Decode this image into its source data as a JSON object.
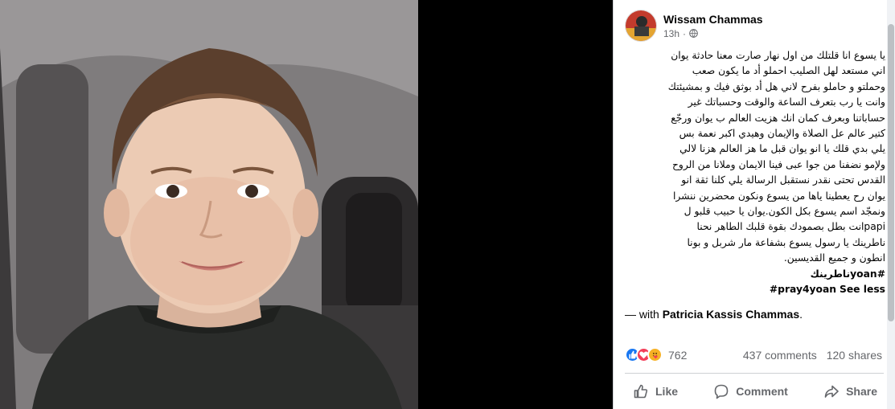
{
  "post": {
    "author": "Wissam Chammas",
    "time": "13h",
    "body_lines": [
      "يا يسوع انا قلتلك من اول نهار صارت معنا حادثة يوان",
      "اني مستعد لهل الصليب احملو أد ما يكون صعب",
      "وحملتو و حاملو بفرح لاني هل أد بوثق فيك و بمشيئتك",
      "وانت يا رب بتعرف الساعة والوقت وحسباتك غير",
      "حساباتنا وبعرف كمان انك هزيت العالم ب يوان ورجّع",
      "كتير عالم عل الصلاة والإيمان وهيدي اكبر نعمة بس",
      "يلي بدي قلك يا انو يوان قبل ما هز العالم هزنا لالي",
      "ولإمو نضفنا من جوا عبى فينا الايمان وملانا من الروح",
      "القدس تحتى نقدر نستقبل الرسالة يلي كلنا ثقة انو",
      "يوان رح يعطينا ياها من يسوع ونكون محضرين ننشرا",
      "ونمجّد اسم يسوع بكل الكون.يوان يا حبيب قلبو ل",
      "papiانت بطل بصمودك بقوة قلبك الطاهر نحنا",
      "ناطرينك يا رسول يسوع بشفاعة مار شربل و بونا",
      "انطون و جميع القديسين."
    ],
    "hashtag_1": "#yoanناطرينك",
    "hashtag_2": "#pray4yoan",
    "see_less": "See less",
    "with_prefix": "— with ",
    "with_name": "Patricia Kassis Chammas",
    "with_suffix": "."
  },
  "stats": {
    "reaction_count": "762",
    "comments": "437 comments",
    "shares": "120 shares"
  },
  "actions": {
    "like": "Like",
    "comment": "Comment",
    "share": "Share"
  },
  "colors": {
    "like_blue": "#1877f2",
    "love_red": "#f33e58",
    "care_yellow": "#f7b125",
    "secondary_text": "#65676b",
    "divider": "#ced0d4"
  },
  "icons": {
    "privacy": "globe-icon",
    "reactions": [
      "like-reaction-icon",
      "love-reaction-icon",
      "care-reaction-icon"
    ],
    "like": "thumbs-up-icon",
    "comment": "speech-bubble-icon",
    "share": "share-arrow-icon"
  }
}
